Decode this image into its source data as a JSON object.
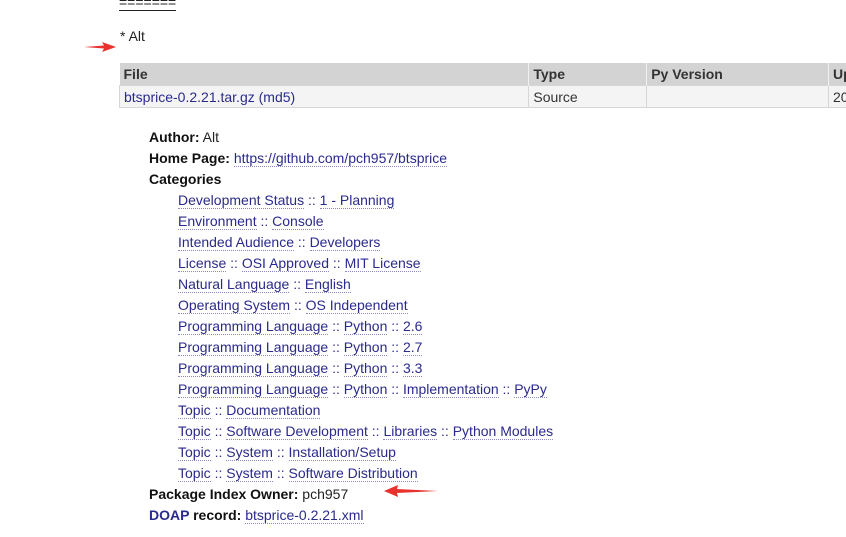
{
  "top_rule": "=======",
  "section": {
    "bullet": "*",
    "title": "Alt"
  },
  "files_table": {
    "headers": [
      "File",
      "Type",
      "Py Version",
      "Up"
    ],
    "rows": [
      {
        "file": "btsprice-0.2.21.tar.gz",
        "md5": "(md5)",
        "type": "Source",
        "py_version": "",
        "uploaded": "20"
      }
    ]
  },
  "meta": {
    "author_label": "Author:",
    "author": "Alt",
    "home_page_label": "Home Page:",
    "home_page": "https://github.com/pch957/btsprice",
    "categories_label": "Categories",
    "categories": [
      [
        "Development Status",
        "1 - Planning"
      ],
      [
        "Environment",
        "Console"
      ],
      [
        "Intended Audience",
        "Developers"
      ],
      [
        "License",
        "OSI Approved",
        "MIT License"
      ],
      [
        "Natural Language",
        "English"
      ],
      [
        "Operating System",
        "OS Independent"
      ],
      [
        "Programming Language",
        "Python",
        "2.6"
      ],
      [
        "Programming Language",
        "Python",
        "2.7"
      ],
      [
        "Programming Language",
        "Python",
        "3.3"
      ],
      [
        "Programming Language",
        "Python",
        "Implementation",
        "PyPy"
      ],
      [
        "Topic",
        "Documentation"
      ],
      [
        "Topic",
        "Software Development",
        "Libraries",
        "Python Modules"
      ],
      [
        "Topic",
        "System",
        "Installation/Setup"
      ],
      [
        "Topic",
        "System",
        "Software Distribution"
      ]
    ],
    "owner_label": "Package Index Owner:",
    "owner": "pch957",
    "doap_abbr": "DOAP",
    "doap_label": "record:",
    "doap_file": "btsprice-0.2.21.xml"
  },
  "colors": {
    "arrow": "#e8322e",
    "link": "#2a2a8c",
    "table_header": "#d3d3d3"
  }
}
